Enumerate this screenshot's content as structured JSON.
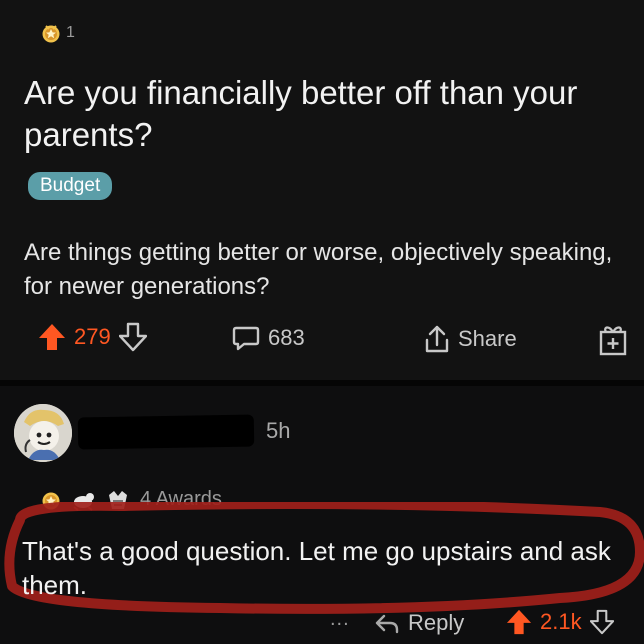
{
  "post": {
    "award_count": "1",
    "title": "Are you financially better off than your parents?",
    "flair": "Budget",
    "body": "Are things getting better or worse, objectively speaking, for newer generations?",
    "score": "279",
    "comments": "683",
    "share_label": "Share",
    "colors": {
      "upvote": "#ff5722",
      "flair": "#5b9ea8",
      "highlight_circle": "#a0201a"
    },
    "icons": [
      "award-icon",
      "upvote-icon",
      "downvote-icon",
      "comment-icon",
      "share-icon",
      "gift-award-icon"
    ]
  },
  "comment": {
    "time": "5h",
    "awards_label": "4 Awards",
    "text": "That's a good question. Let me go upstairs and ask them.",
    "more": "...",
    "reply_label": "Reply",
    "score": "2.1k",
    "icons": [
      "avatar",
      "award-icon",
      "reply-icon",
      "upvote-icon",
      "downvote-icon"
    ]
  }
}
